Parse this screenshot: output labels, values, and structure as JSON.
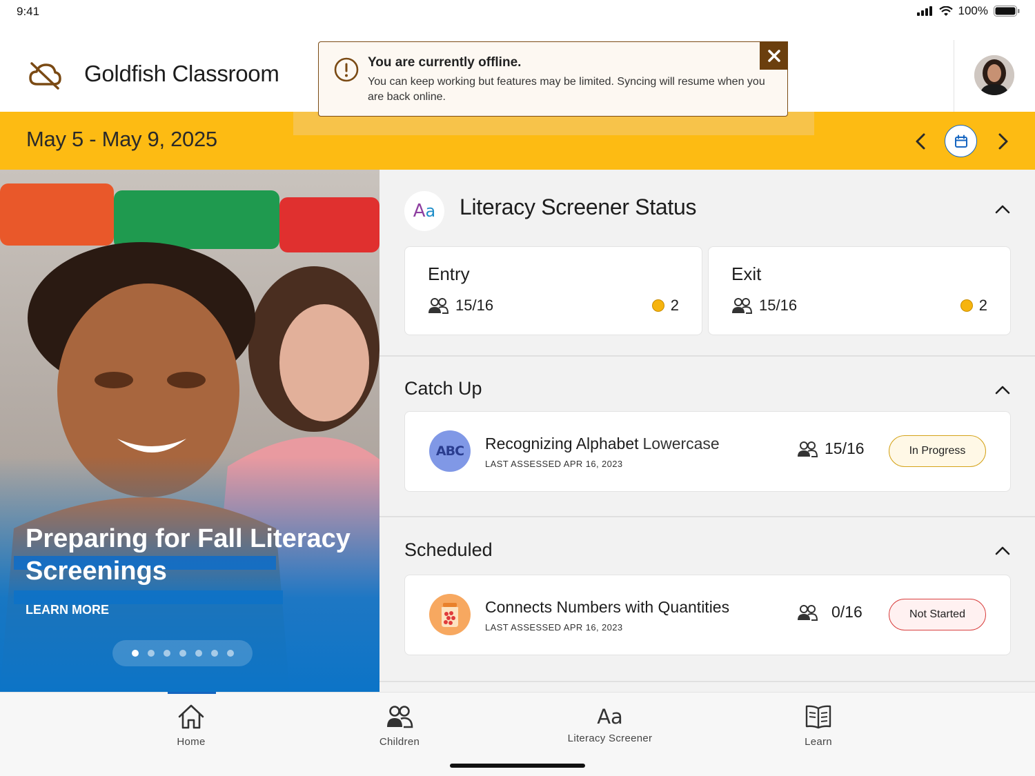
{
  "status_bar": {
    "time": "9:41",
    "battery": "100%"
  },
  "header": {
    "title": "Goldfish Classroom",
    "avatar_icon": "user-avatar"
  },
  "toast": {
    "title": "You are currently offline.",
    "message": "You can keep working but features may be limited. Syncing will resume when you are back online.",
    "icon": "exclamation-circle-icon",
    "close_icon": "close-icon",
    "border_color": "#7a4a14"
  },
  "date_bar": {
    "range": "May 5 - May 9, 2025",
    "color": "#fdbb13"
  },
  "hero": {
    "title": "Preparing for Fall Literacy Screenings",
    "link": "LEARN MORE",
    "slide_count": 7,
    "active_slide": 1
  },
  "literacy_status": {
    "title": "Literacy Screener Status",
    "entry": {
      "label": "Entry",
      "count": "15/16",
      "alerts": "2"
    },
    "exit": {
      "label": "Exit",
      "count": "15/16",
      "alerts": "2"
    }
  },
  "catch_up": {
    "title": "Catch Up",
    "items": [
      {
        "name": "Recognizing Alphabet",
        "sub": "Lowercase",
        "date": "LAST ASSESSED APR 16, 2023",
        "count": "15/16",
        "status": "In Progress",
        "icon": "abc-icon"
      }
    ]
  },
  "scheduled": {
    "title": "Scheduled",
    "items": [
      {
        "name": "Connects Numbers with Quantities",
        "date": "LAST ASSESSED APR 16, 2023",
        "count": "0/16",
        "status": "Not Started",
        "icon": "counting-jar-icon"
      }
    ]
  },
  "tabs": [
    {
      "label": "Home",
      "icon": "home-icon",
      "active": true
    },
    {
      "label": "Children",
      "icon": "children-icon"
    },
    {
      "label": "Literacy Screener",
      "icon": "literacy-icon"
    },
    {
      "label": "Learn",
      "icon": "book-icon"
    }
  ]
}
